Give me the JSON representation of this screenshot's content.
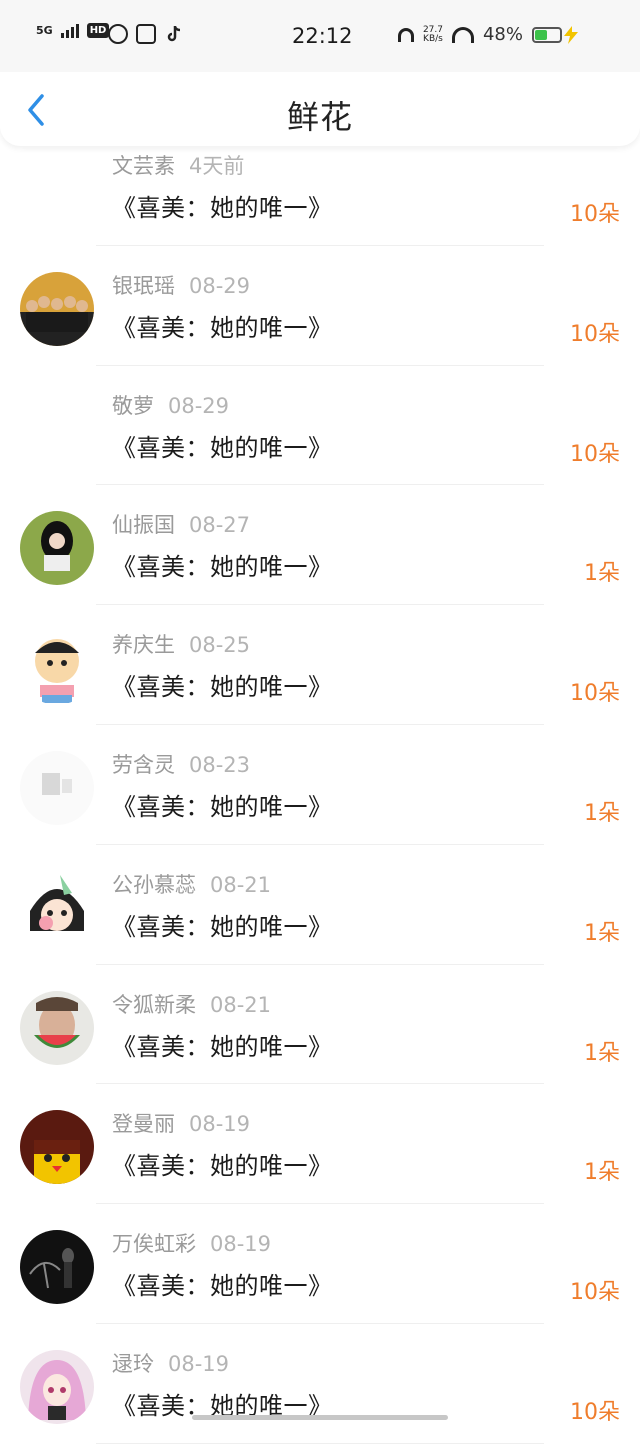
{
  "status_bar": {
    "network": "5G",
    "hd": "HD",
    "time": "22:12",
    "net_speed_value": "27.7",
    "net_speed_unit": "KB/s",
    "battery_percent": "48%"
  },
  "nav": {
    "title": "鲜花"
  },
  "items": [
    {
      "name": "文芸素",
      "date": "4天前",
      "title": "《喜美：她的唯一》",
      "count": "10朵",
      "avatar": "none"
    },
    {
      "name": "银珉瑶",
      "date": "08-29",
      "title": "《喜美：她的唯一》",
      "count": "10朵",
      "avatar": "group"
    },
    {
      "name": "敬萝",
      "date": "08-29",
      "title": "《喜美：她的唯一》",
      "count": "10朵",
      "avatar": "none"
    },
    {
      "name": "仙振国",
      "date": "08-27",
      "title": "《喜美：她的唯一》",
      "count": "1朵",
      "avatar": "girl-dark"
    },
    {
      "name": "养庆生",
      "date": "08-25",
      "title": "《喜美：她的唯一》",
      "count": "10朵",
      "avatar": "cartoon-boy"
    },
    {
      "name": "劳含灵",
      "date": "08-23",
      "title": "《喜美：她的唯一》",
      "count": "1朵",
      "avatar": "faded"
    },
    {
      "name": "公孙慕蕊",
      "date": "08-21",
      "title": "《喜美：她的唯一》",
      "count": "1朵",
      "avatar": "anime-girl"
    },
    {
      "name": "令狐新柔",
      "date": "08-21",
      "title": "《喜美：她的唯一》",
      "count": "1朵",
      "avatar": "watermelon-man"
    },
    {
      "name": "登曼丽",
      "date": "08-19",
      "title": "《喜美：她的唯一》",
      "count": "1朵",
      "avatar": "yellow-face"
    },
    {
      "name": "万俟虹彩",
      "date": "08-19",
      "title": "《喜美：她的唯一》",
      "count": "10朵",
      "avatar": "dark-umbrella"
    },
    {
      "name": "逯玲",
      "date": "08-19",
      "title": "《喜美：她的唯一》",
      "count": "10朵",
      "avatar": "pink-hair"
    }
  ],
  "colors": {
    "accent_orange": "#ef7d2c",
    "back_blue": "#2f8fe6"
  }
}
